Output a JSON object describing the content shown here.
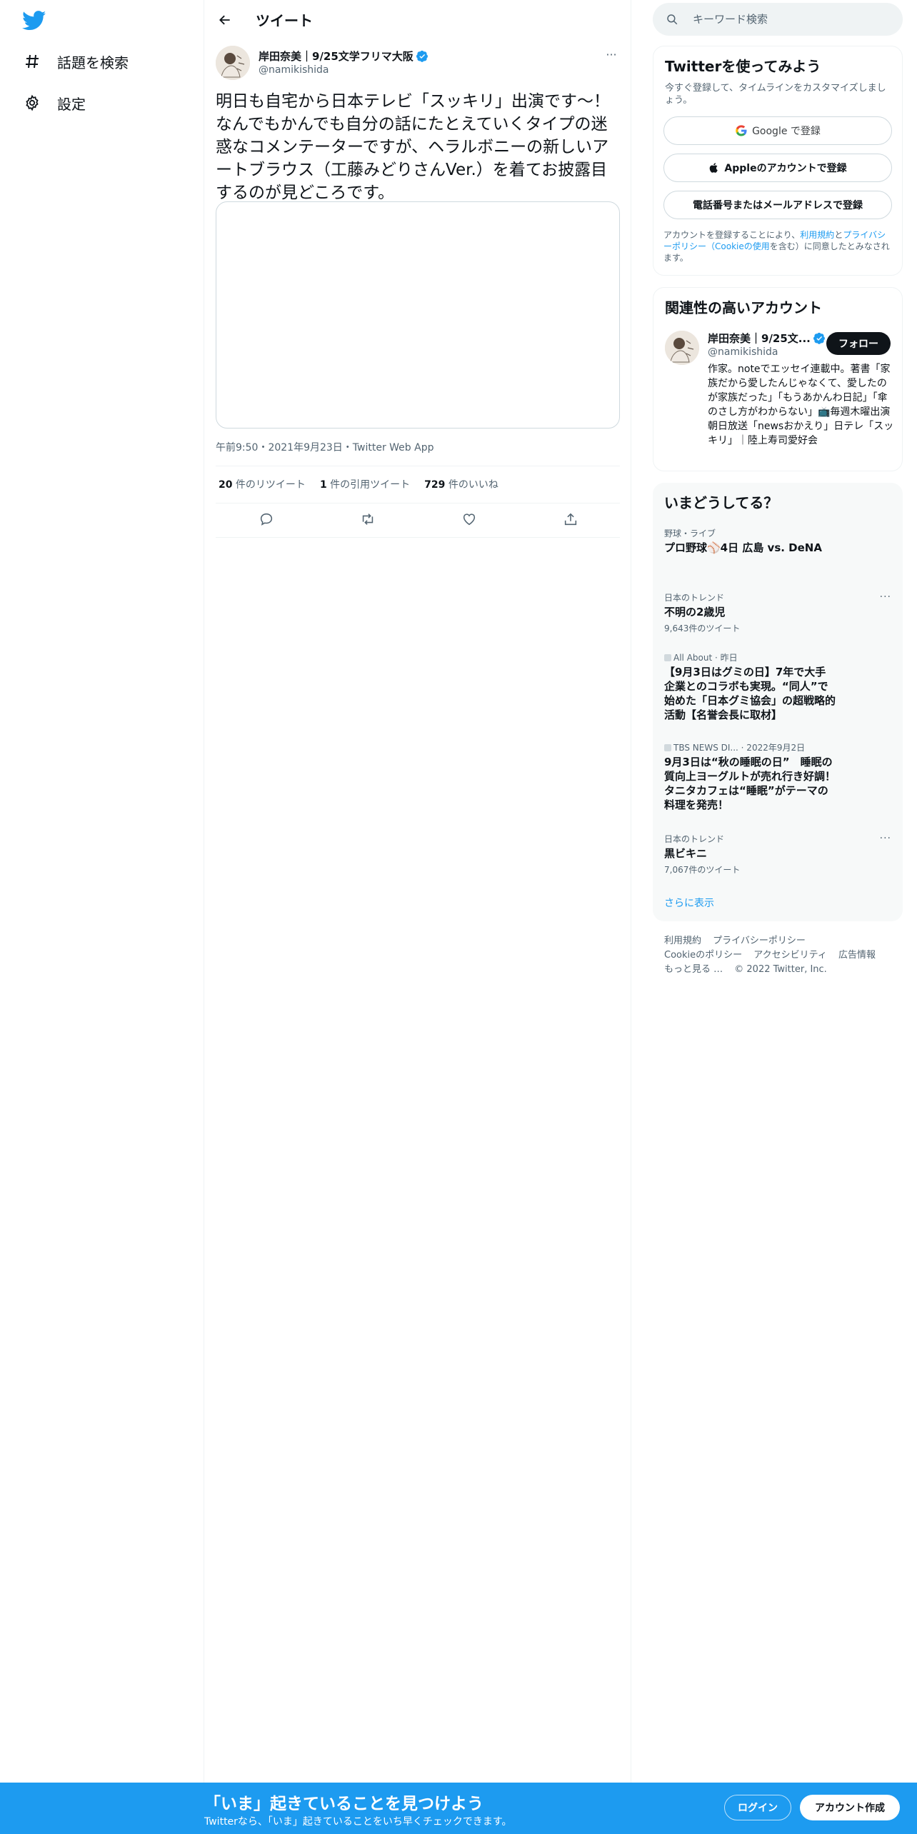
{
  "nav": {
    "logo_icon": "twitter-bird-icon",
    "items": [
      {
        "icon": "hashtag-icon",
        "label": "話題を検索"
      },
      {
        "icon": "gear-icon",
        "label": "設定"
      }
    ]
  },
  "header": {
    "title": "ツイート"
  },
  "tweet": {
    "author_name": "岸田奈美｜9/25文学フリマ大阪",
    "author_handle": "@namikishida",
    "text": "明日も自宅から日本テレビ「スッキリ」出演です〜！なんでもかんでも自分の話にたとえていくタイプの迷惑なコメンテーターですが、ヘラルボニーの新しいアートブラウス（工藤みどりさんVer.）を着てお披露目するのが見どころです。",
    "meta": "午前9:50・2021年9月23日・Twitter Web App",
    "retweets": "20",
    "retweets_label": " 件のリツイート",
    "quotes": "1",
    "quotes_label": " 件の引用ツイート",
    "likes": "729",
    "likes_label": " 件のいいね"
  },
  "search": {
    "placeholder": "キーワード検索"
  },
  "signup": {
    "title": "Twitterを使ってみよう",
    "subtitle": "今すぐ登録して、タイムラインをカスタマイズしましょう。",
    "google_label": "Google で登録",
    "apple_label": "Appleのアカウントで登録",
    "phone_label": "電話番号またはメールアドレスで登録",
    "legal_prefix": "アカウントを登録することにより、",
    "legal_terms": "利用規約",
    "legal_and": "と",
    "legal_privacy": "プライバシーポリシー（Cookieの使用",
    "legal_suffix": "を含む）に同意したとみなされます。"
  },
  "related": {
    "title": "関連性の高いアカウント",
    "name": "岸田奈美｜9/25文...",
    "handle": "@namikishida",
    "follow_label": "フォロー",
    "bio": "作家。noteでエッセイ連載中。著書「家族だから愛したんじゃなくて、愛したのが家族だった」「もうあかんわ日記」「傘のさし方がわからない」📺毎週木曜出演 朝日放送「newsおかえり」日テレ「スッキリ」｜陸上寿司愛好会"
  },
  "trends": {
    "title": "いまどうしてる？",
    "items": [
      {
        "context": "野球・ライブ",
        "title": "プロ野球⚾4日 広島 vs. DeNA",
        "count": ""
      },
      {
        "context": "日本のトレンド",
        "title": "不明の2歳児",
        "count": "9,643件のツイート"
      },
      {
        "context": "All About · 昨日",
        "title": "【9月3日はグミの日】7年で大手企業とのコラボも実現。“同人”で始めた「日本グミ協会」の超戦略的活動【名誉会長に取材】",
        "count": ""
      },
      {
        "context": "TBS NEWS DI... · 2022年9月2日",
        "title": "9月3日は“秋の睡眠の日”　睡眠の質向上ヨーグルトが売れ行き好調！　タニタカフェは“睡眠”がテーマの料理を発売！",
        "count": ""
      },
      {
        "context": "日本のトレンド",
        "title": "黒ビキニ",
        "count": "7,067件のツイート"
      }
    ],
    "more_label": "···",
    "show_more": "さらに表示"
  },
  "footer": {
    "links": [
      "利用規約",
      "プライバシーポリシー",
      "Cookieのポリシー",
      "アクセシビリティ",
      "広告情報",
      "もっと見る …",
      "© 2022 Twitter, Inc."
    ]
  },
  "bottom": {
    "title": "「いま」起きていることを見つけよう",
    "subtitle": "Twitterなら、「いま」起きていることをいち早くチェックできます。",
    "login_label": "ログイン",
    "signup_label": "アカウント作成"
  },
  "colors": {
    "accent": "#1d9bf0",
    "text": "#0f1419",
    "muted": "#536471"
  }
}
